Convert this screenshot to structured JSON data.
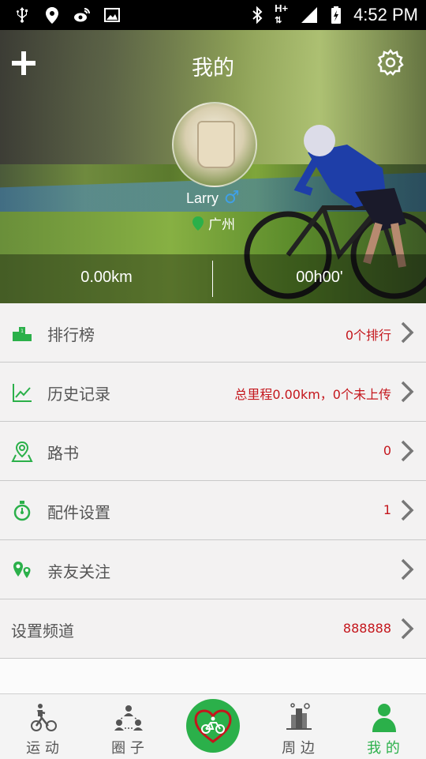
{
  "status_bar": {
    "time": "4:52 PM",
    "left_icons": [
      "usb-icon",
      "location-pin-icon",
      "weibo-icon",
      "image-icon"
    ],
    "right_icons": [
      "bluetooth-icon",
      "hplus-network-icon",
      "signal-icon",
      "battery-charging-icon"
    ],
    "network_label": "H+"
  },
  "header": {
    "title": "我的",
    "add_icon": "plus-icon",
    "settings_icon": "gear-icon"
  },
  "profile": {
    "username": "Larry",
    "gender_symbol": "♂",
    "city": "广州"
  },
  "stats": {
    "distance": "0.00km",
    "duration": "00h00'"
  },
  "menu": [
    {
      "label": "排行榜",
      "value": "0个排行",
      "icon": "podium-icon"
    },
    {
      "label": "历史记录",
      "value": "总里程0.00km，0个未上传",
      "icon": "line-chart-icon"
    },
    {
      "label": "路书",
      "value": "0",
      "icon": "map-pin-icon"
    },
    {
      "label": "配件设置",
      "value": "1",
      "icon": "stopwatch-icon"
    },
    {
      "label": "亲友关注",
      "value": "",
      "icon": "location-pair-icon"
    },
    {
      "label": "设置频道",
      "value": "888888",
      "icon": ""
    }
  ],
  "tabs": [
    {
      "label": "运 动",
      "icon": "cyclist-icon",
      "active": false
    },
    {
      "label": "圈 子",
      "icon": "group-icon",
      "active": false
    },
    {
      "label": "",
      "icon": "heart-bike-icon",
      "active": false
    },
    {
      "label": "周 边",
      "icon": "nearby-city-icon",
      "active": false
    },
    {
      "label": "我 的",
      "icon": "person-icon",
      "active": true
    }
  ],
  "colors": {
    "accent_green": "#2bb04a",
    "value_red": "#c4161c",
    "status_bar": "#000000"
  }
}
